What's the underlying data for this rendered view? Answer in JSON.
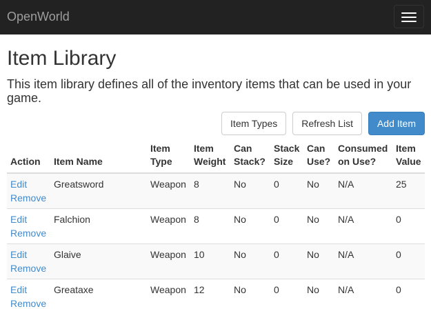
{
  "navbar": {
    "brand": "OpenWorld",
    "toggle_icon": "hamburger-menu-icon"
  },
  "page": {
    "title": "Item Library",
    "description": "This item library defines all of the inventory items that can be used in your game."
  },
  "toolbar": {
    "item_types_label": "Item Types",
    "refresh_label": "Refresh List",
    "add_label": "Add Item"
  },
  "colors": {
    "navbar_bg": "#222222",
    "primary": "#428bca",
    "link": "#428bca",
    "stripe": "#f9f9f9"
  },
  "table": {
    "headers": {
      "action": "Action",
      "name": "Item Name",
      "type": "Item Type",
      "weight": "Item Weight",
      "can_stack": "Can Stack?",
      "stack_size": "Stack Size",
      "can_use": "Can Use?",
      "consumed": "Consumed on Use?",
      "value": "Item Value"
    },
    "rows": [
      {
        "edit": "Edit",
        "remove": "Remove",
        "name": "Greatsword",
        "type": "Weapon",
        "weight": "8",
        "can_stack": "No",
        "stack_size": "0",
        "can_use": "No",
        "consumed": "N/A",
        "value": "25"
      },
      {
        "edit": "Edit",
        "remove": "Remove",
        "name": "Falchion",
        "type": "Weapon",
        "weight": "8",
        "can_stack": "No",
        "stack_size": "0",
        "can_use": "No",
        "consumed": "N/A",
        "value": "0"
      },
      {
        "edit": "Edit",
        "remove": "Remove",
        "name": "Glaive",
        "type": "Weapon",
        "weight": "10",
        "can_stack": "No",
        "stack_size": "0",
        "can_use": "No",
        "consumed": "N/A",
        "value": "0"
      },
      {
        "edit": "Edit",
        "remove": "Remove",
        "name": "Greataxe",
        "type": "Weapon",
        "weight": "12",
        "can_stack": "No",
        "stack_size": "0",
        "can_use": "No",
        "consumed": "N/A",
        "value": "0"
      }
    ]
  }
}
